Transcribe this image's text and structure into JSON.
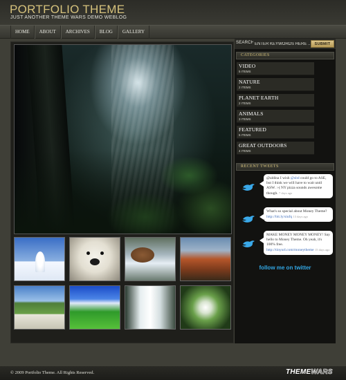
{
  "header": {
    "title": "PORTFOLIO THEME",
    "tagline": "JUST ANOTHER THEME WARS DEMO WEBLOG"
  },
  "nav": [
    "HOME",
    "ABOUT",
    "ARCHIVES",
    "BLOG",
    "GALLERY"
  ],
  "search": {
    "label": "SEARCH",
    "placeholder": "ENTER KEYWORDS HERE ...",
    "submit": "SUBMIT"
  },
  "categories": {
    "heading": "CATEGORIES",
    "items": [
      {
        "name": "VIDEO",
        "count": "5 ITEMS"
      },
      {
        "name": "NATURE",
        "count": "2 ITEMS"
      },
      {
        "name": "PLANET EARTH",
        "count": "2 ITEMS"
      },
      {
        "name": "ANIMALS",
        "count": "3 ITEMS"
      },
      {
        "name": "FEATURED",
        "count": "5 ITEMS"
      },
      {
        "name": "GREAT OUTDOORS",
        "count": "4 ITEMS"
      }
    ]
  },
  "tweets": {
    "heading": "RECENT TWEETS",
    "items": [
      {
        "pre": "@aldina I wish ",
        "mention": "@sbd",
        "text": " could go to ASE, but I think we will have to wait until ASW. :-( NY pizza sounds awesome though.",
        "time": "7 days ago"
      },
      {
        "pre": "What's so special about Money Theme? ",
        "mention": "http://bit.ly/siufq",
        "text": "",
        "time": "13 days ago"
      },
      {
        "pre": "MAKE MONEY MONEY MONEY! Say hello to Money Theme. Oh yeah, it's 100% free. ",
        "mention": "http://tinyurl.com/moneytheme",
        "text": "",
        "time": "15 days ago"
      }
    ],
    "follow": "follow me on twitter"
  },
  "gallery": {
    "thumbs": [
      "winter-landscape",
      "polar-bear",
      "bear-waterfall",
      "autumn-valley",
      "white-cliffs",
      "green-field",
      "waterfall",
      "dandelion"
    ]
  },
  "footer": {
    "copyright": "© 2009 Portfolio Theme. All Rights Reserved.",
    "brand_a": "THEME",
    "brand_b": "WARS"
  }
}
